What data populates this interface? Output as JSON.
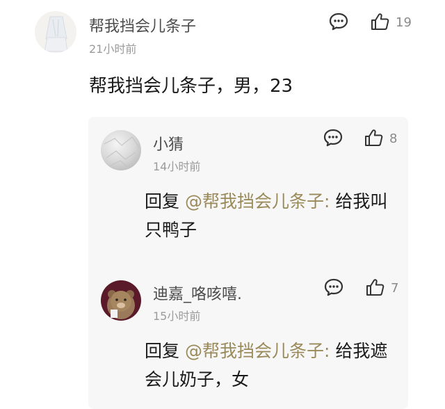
{
  "comment": {
    "username": "帮我挡会儿条子",
    "time": "21小时前",
    "text": "帮我挡会儿条子，男，23",
    "like_count": "19"
  },
  "replies": [
    {
      "username": "小猜",
      "time": "14小时前",
      "reply_prefix": "回复 ",
      "mention": "@帮我挡会儿条子:",
      "text_line1": " 给我叫",
      "text_line2": "只鸭子",
      "like_count": "8"
    },
    {
      "username": "迪嘉_咯咳嘻.",
      "time": "15小时前",
      "reply_prefix": "回复 ",
      "mention": "@帮我挡会儿条子:",
      "text_line1": " 给我遮",
      "text_line2": "会儿奶子，女",
      "like_count": "7"
    }
  ],
  "colors": {
    "mention": "#9a8a5a",
    "reply_bg": "#f7f7f7"
  },
  "icons": [
    "comment-icon",
    "thumbs-up-icon"
  ]
}
